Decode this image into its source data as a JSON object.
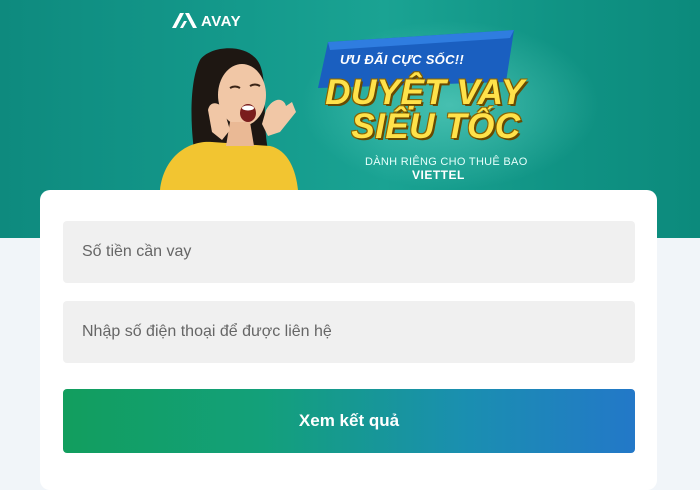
{
  "brand": {
    "logo_text": "AVAY"
  },
  "banner": {
    "promo_tag": "ƯU ĐÃI CỰC SỐC!!",
    "headline_line1": "DUYỆT VAY",
    "headline_line2": "SIÊU TỐC",
    "subtitle": "DÀNH RIÊNG CHO THUÊ BAO",
    "carrier": "VIETTEL"
  },
  "form": {
    "amount_placeholder": "Số tiền cần vay",
    "amount_value": "",
    "phone_placeholder": "Nhập số điện thoại để được liên hệ",
    "phone_value": "",
    "submit_label": "Xem kết quả"
  },
  "colors": {
    "banner_bg": "#149a8c",
    "headline": "#ffe24a",
    "promo_tag": "#1a5fc0",
    "button_start": "#129e5e",
    "button_end": "#2378c8"
  }
}
